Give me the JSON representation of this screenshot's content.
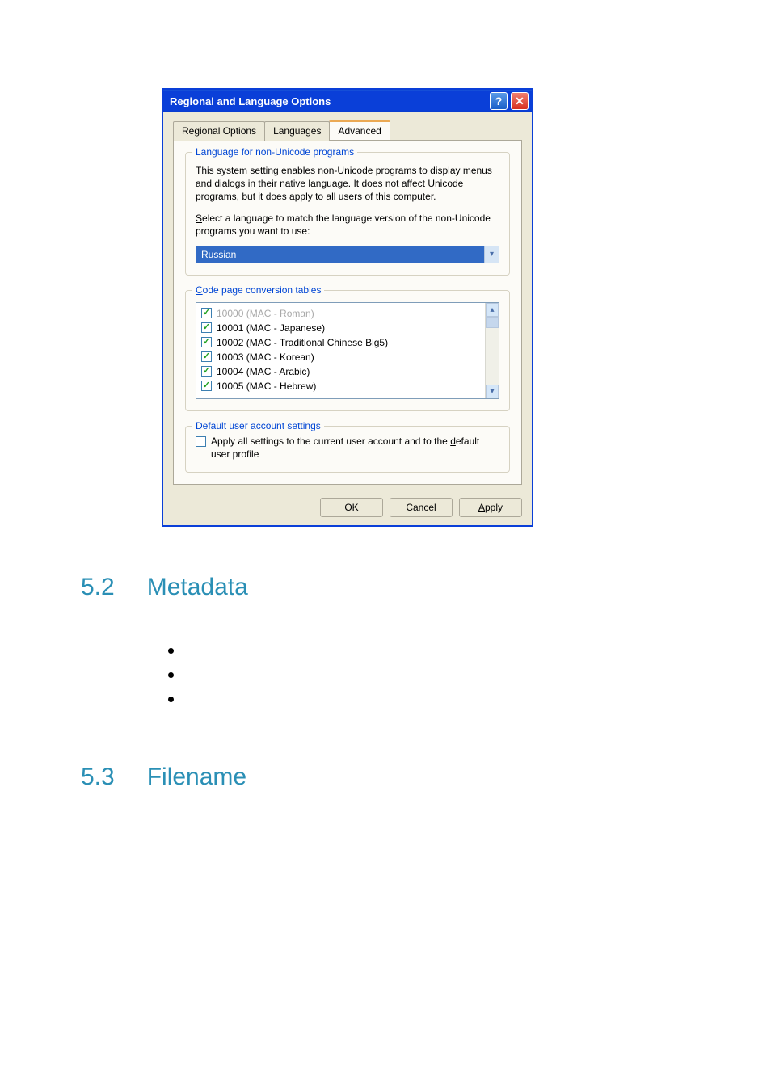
{
  "dialog": {
    "title": "Regional and Language Options",
    "tabs": [
      "Regional Options",
      "Languages",
      "Advanced"
    ],
    "active_tab_index": 2,
    "group1": {
      "legend": "Language for non-Unicode programs",
      "desc1": "This system setting enables non-Unicode programs to display menus and dialogs in their native language. It does not affect Unicode programs, but it does apply to all users of this computer.",
      "desc2_pre": "S",
      "desc2_rest": "elect a language to match the language version of the non-Unicode programs you want to use:",
      "combo_value": "Russian"
    },
    "group2": {
      "legend_pre": "C",
      "legend_rest": "ode page conversion tables",
      "items": [
        {
          "label": "10000 (MAC - Roman)",
          "checked": true,
          "disabled": true
        },
        {
          "label": "10001 (MAC - Japanese)",
          "checked": true,
          "disabled": false
        },
        {
          "label": "10002 (MAC - Traditional Chinese Big5)",
          "checked": true,
          "disabled": false
        },
        {
          "label": "10003 (MAC - Korean)",
          "checked": true,
          "disabled": false
        },
        {
          "label": "10004 (MAC - Arabic)",
          "checked": true,
          "disabled": false
        },
        {
          "label": "10005 (MAC - Hebrew)",
          "checked": true,
          "disabled": false
        }
      ]
    },
    "group3": {
      "legend": "Default user account settings",
      "checkbox_pre": "Apply all settings to the current user account and to the ",
      "checkbox_u": "d",
      "checkbox_post": "efault user profile"
    },
    "buttons": {
      "ok": "OK",
      "cancel": "Cancel",
      "apply_pre": "A",
      "apply_rest": "pply"
    }
  },
  "sections": {
    "s52_num": "5.2",
    "s52_title": "Metadata",
    "s53_num": "5.3",
    "s53_title": "Filename"
  }
}
